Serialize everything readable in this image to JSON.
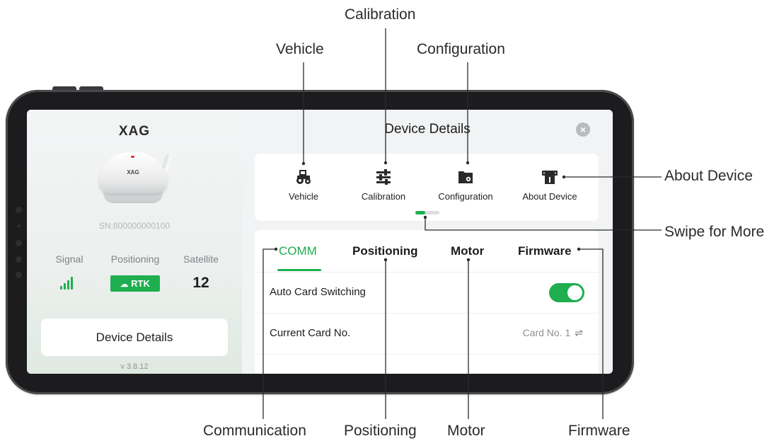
{
  "left_panel": {
    "brand": "XAG",
    "device_logo": "XAG",
    "serial_number": "SN:800000000100",
    "stats": {
      "signal_label": "Signal",
      "positioning_label": "Positioning",
      "satellite_label": "Satellite",
      "positioning_value": "RTK",
      "satellite_value": "12"
    },
    "details_button": "Device Details",
    "version": "v 3.8.12"
  },
  "right_panel": {
    "title": "Device Details",
    "close_icon": "close-icon",
    "shortcuts": [
      {
        "label": "Vehicle",
        "icon": "tractor-icon"
      },
      {
        "label": "Calibration",
        "icon": "sliders-icon"
      },
      {
        "label": "Configuration",
        "icon": "folder-gear-icon"
      },
      {
        "label": "About Device",
        "icon": "device-info-icon"
      }
    ],
    "tabs": [
      {
        "label": "COMM",
        "active": true
      },
      {
        "label": "Positioning",
        "active": false
      },
      {
        "label": "Motor",
        "active": false
      },
      {
        "label": "Firmware",
        "active": false
      }
    ],
    "rows": [
      {
        "label": "Auto Card Switching",
        "toggle_on": true
      },
      {
        "label": "Current Card No.",
        "value": "Card No. 1",
        "value_icon": "swap-icon"
      }
    ]
  },
  "callouts": {
    "calibration": "Calibration",
    "vehicle": "Vehicle",
    "configuration": "Configuration",
    "about_device": "About Device",
    "swipe_for_more": "Swipe for More",
    "communication": "Communication",
    "positioning": "Positioning",
    "motor": "Motor",
    "firmware": "Firmware"
  },
  "colors": {
    "accent_green": "#1fae50",
    "frame": "#1c1c1e",
    "panel_bg": "#f2f3f4"
  }
}
